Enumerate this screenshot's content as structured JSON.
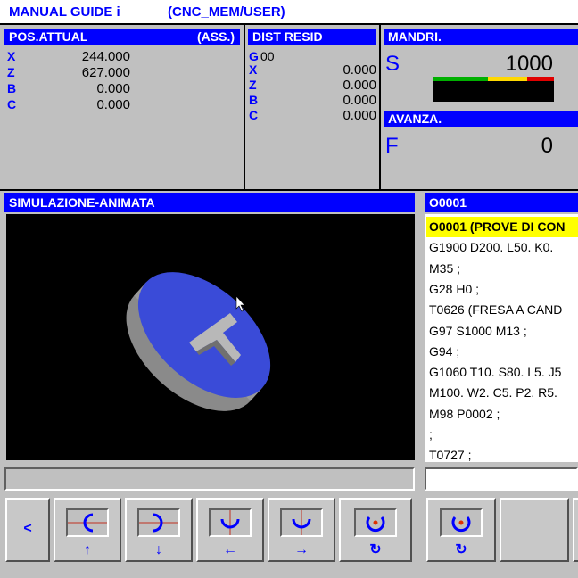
{
  "header": {
    "title": "MANUAL GUIDE i",
    "path": "(CNC_MEM/USER)"
  },
  "pos_panel": {
    "title": "POS.ATTUAL",
    "mode": "(ASS.)",
    "axes": [
      {
        "label": "X",
        "value": "244.000"
      },
      {
        "label": "Z",
        "value": "627.000"
      },
      {
        "label": "B",
        "value": "0.000"
      },
      {
        "label": "C",
        "value": "0.000"
      }
    ]
  },
  "dist_panel": {
    "title": "DIST RESID",
    "g_label": "G",
    "g_value": "00",
    "axes": [
      {
        "label": "X",
        "value": "0.000"
      },
      {
        "label": "Z",
        "value": "0.000"
      },
      {
        "label": "B",
        "value": "0.000"
      },
      {
        "label": "C",
        "value": "0.000"
      }
    ]
  },
  "spindle": {
    "title": "MANDRI.",
    "letter": "S",
    "value": "1000"
  },
  "feed": {
    "title": "AVANZA.",
    "letter": "F",
    "value": "0"
  },
  "simulation": {
    "title": "SIMULAZIONE-ANIMATA"
  },
  "program": {
    "title": "O0001",
    "lines": [
      "O0001 (PROVE DI CON",
      "G1900 D200. L50. K0.",
      "M35 ;",
      "G28 H0 ;",
      "T0626 (FRESA A CAND",
      "G97 S1000 M13 ;",
      "G94 ;",
      "G1060 T10. S80. L5. J5",
      "M100. W2. C5. P2. R5.",
      "M98 P0002 ;",
      ";",
      "T0727 ;"
    ]
  },
  "softkeys": {
    "back": "<",
    "arrows": [
      "↑",
      "↓",
      "←",
      "→",
      "↻",
      "↻"
    ]
  },
  "colors": {
    "title_blue": "#0000ff",
    "highlight": "#ffff00",
    "panel": "#c0c0c0"
  }
}
